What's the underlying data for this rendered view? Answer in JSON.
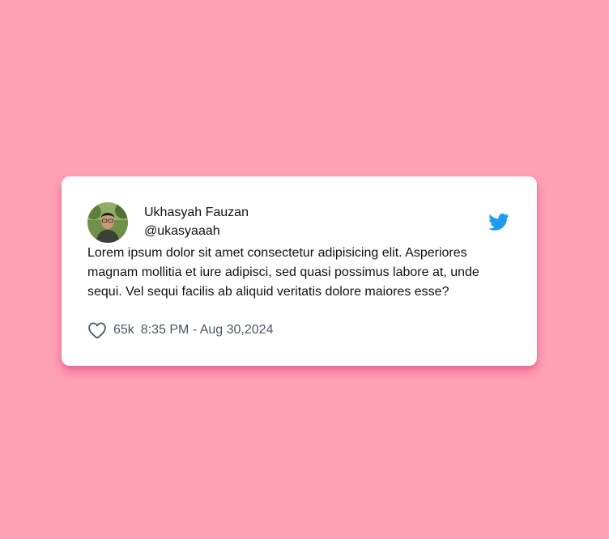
{
  "tweet": {
    "author_name": "Ukhasyah Fauzan",
    "author_handle": "@ukasyaaah",
    "text": "Lorem ipsum dolor sit amet consectetur adipisicing elit. Asperiores magnam mollitia et iure adipisci, sed quasi possimus labore at, unde sequi. Vel sequi facilis ab aliquid veritatis dolore maiores esse?",
    "likes": "65k",
    "timestamp": "8:35 PM - Aug 30,2024"
  },
  "icons": {
    "brand": "twitter-bird-icon",
    "like": "heart-outline-icon"
  },
  "colors": {
    "page_background": "#ffa1b5",
    "card_background": "#ffffff",
    "twitter_blue": "#1d9bf0",
    "meta_text": "#4b5563"
  }
}
